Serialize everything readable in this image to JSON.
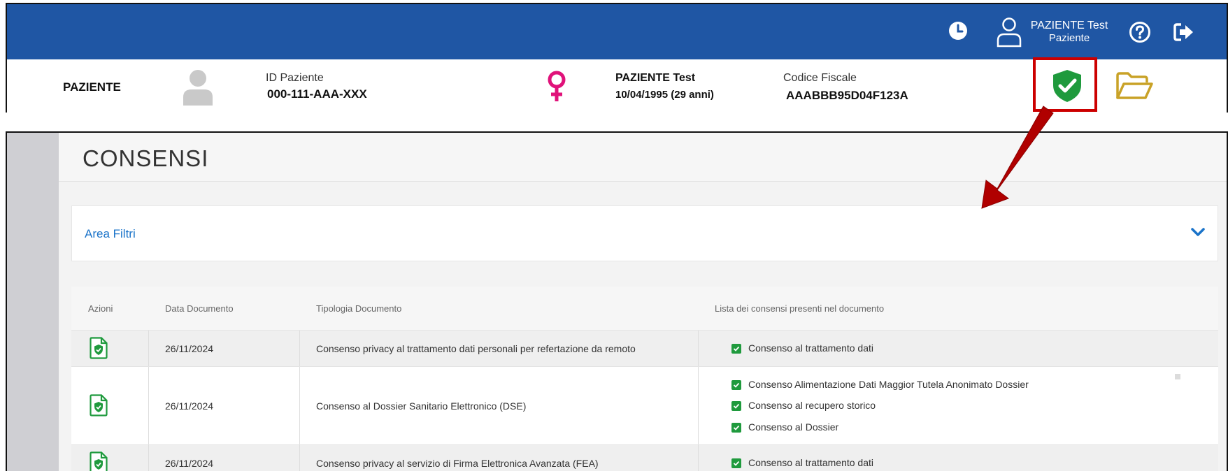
{
  "header": {
    "user_name": "PAZIENTE Test",
    "user_role": "Paziente",
    "icons": [
      "clock-icon",
      "user-icon",
      "help-icon",
      "logout-icon"
    ],
    "bar_color": "#1f56a4"
  },
  "patient": {
    "section_label": "PAZIENTE",
    "id_label": "ID Paziente",
    "id_value": "000-111-AAA-XXX",
    "name": "PAZIENTE Test",
    "dob": "10/04/1995 (29 anni)",
    "cf_label": "Codice Fiscale",
    "cf_value": "AAABBB95D04F123A",
    "gender_icon": "female-icon",
    "gender_color": "#e0127a",
    "consent_icon": "shield-check-icon",
    "consent_color": "#1f9a3d",
    "folder_icon": "folder-open-icon",
    "folder_color": "#c9a227"
  },
  "main": {
    "title": "CONSENSI",
    "filter_label": "Area Filtri",
    "table": {
      "headers": {
        "actions": "Azioni",
        "date": "Data Documento",
        "type": "Tipologia Documento",
        "consents": "Lista dei consensi presenti nel documento"
      },
      "rows": [
        {
          "date": "26/11/2024",
          "type": "Consenso privacy al trattamento dati personali per refertazione da remoto",
          "consents": [
            "Consenso al trattamento dati"
          ]
        },
        {
          "date": "26/11/2024",
          "type": "Consenso al Dossier Sanitario Elettronico (DSE)",
          "consents": [
            "Consenso Alimentazione Dati Maggior Tutela Anonimato Dossier",
            "Consenso al recupero storico",
            "Consenso al Dossier"
          ]
        },
        {
          "date": "26/11/2024",
          "type": "Consenso privacy al servizio di Firma Elettronica Avanzata (FEA)",
          "consents": [
            "Consenso al trattamento dati"
          ]
        }
      ]
    }
  },
  "annotation": {
    "arrow_color": "#c00000",
    "highlight_color": "#cc0000"
  }
}
